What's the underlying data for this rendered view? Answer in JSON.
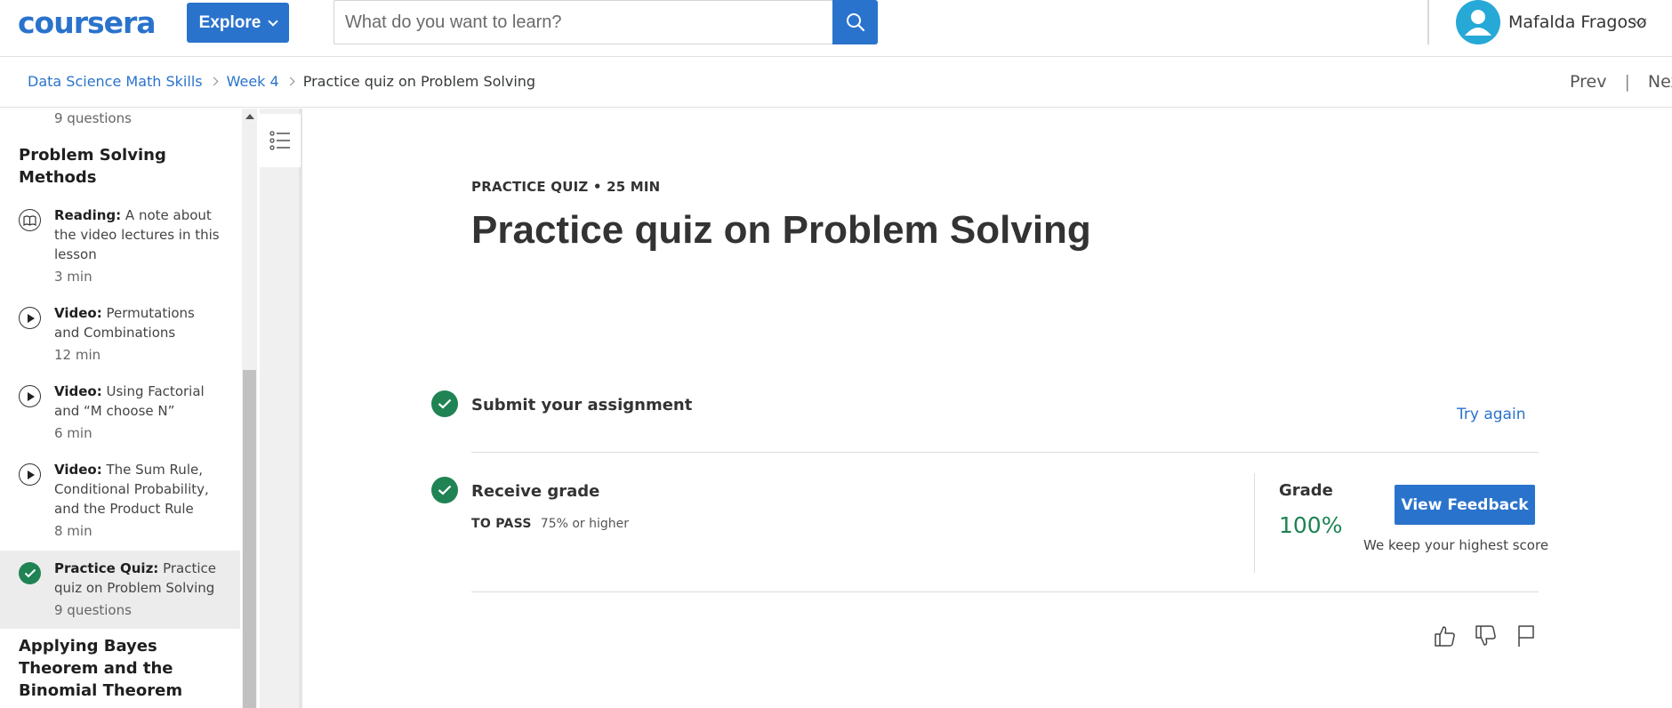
{
  "header": {
    "logo": "coursera",
    "explore_label": "Explore",
    "search": {
      "placeholder": "What do you want to learn?",
      "value": ""
    },
    "user_name": "Mafalda Fragoso"
  },
  "breadcrumb": {
    "items": [
      "Data Science Math Skills",
      "Week 4",
      "Practice quiz on Problem Solving"
    ],
    "prev": "Prev",
    "next": "Next"
  },
  "sidebar": {
    "top_meta": "9 questions",
    "section_1": "Problem Solving Methods",
    "items": [
      {
        "kind": "Reading:",
        "title": "A note about the video lectures in this lesson",
        "meta": "3 min",
        "icon": "book-icon"
      },
      {
        "kind": "Video:",
        "title": "Permutations and Combinations",
        "meta": "12 min",
        "icon": "play-icon"
      },
      {
        "kind": "Video:",
        "title": "Using Factorial and “M choose N”",
        "meta": "6 min",
        "icon": "play-icon"
      },
      {
        "kind": "Video:",
        "title": "The Sum Rule, Conditional Probability, and the Product Rule",
        "meta": "8 min",
        "icon": "play-icon"
      },
      {
        "kind": "Practice Quiz:",
        "title": "Practice quiz on Problem Solving",
        "meta": "9 questions",
        "icon": "check-icon",
        "active": true
      }
    ],
    "section_2": "Applying Bayes Theorem and the Binomial Theorem"
  },
  "main": {
    "kicker": "PRACTICE QUIZ • 25 MIN",
    "title": "Practice quiz on Problem Solving",
    "submit_label": "Submit your assignment",
    "try_again": "Try again",
    "receive_grade": "Receive grade",
    "to_pass_label": "TO PASS",
    "to_pass_value": "75% or higher",
    "grade_label": "Grade",
    "grade_value": "100%",
    "view_feedback": "View Feedback",
    "keep_score": "We keep your highest score"
  },
  "colors": {
    "brand": "#2a73cc",
    "success": "#1f8354",
    "active_bg": "#ececec"
  }
}
